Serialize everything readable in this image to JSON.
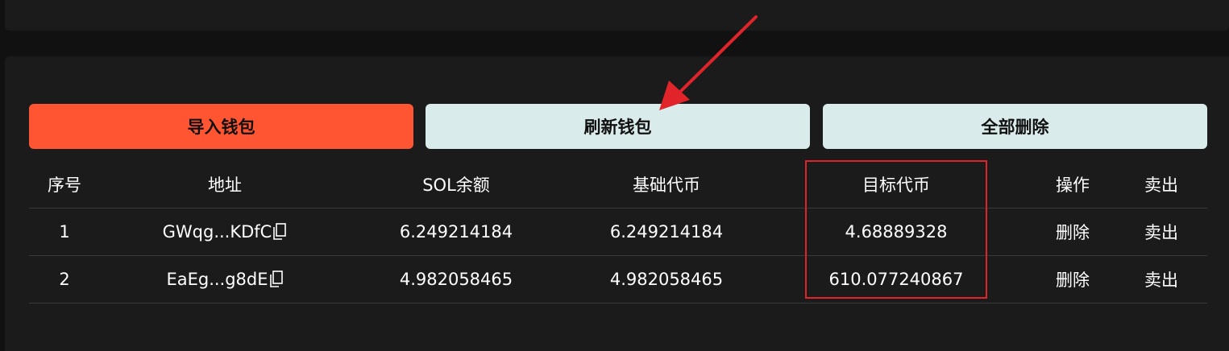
{
  "buttons": {
    "import": "导入钱包",
    "refresh": "刷新钱包",
    "delete_all": "全部删除"
  },
  "table": {
    "headers": {
      "index": "序号",
      "address": "地址",
      "sol_balance": "SOL余额",
      "base_token": "基础代币",
      "target_token": "目标代币",
      "operation": "操作",
      "sell": "卖出"
    },
    "rows": [
      {
        "index": "1",
        "address": "GWqg...KDfC",
        "sol_balance": "6.249214184",
        "base_token": "6.249214184",
        "target_token": "4.68889328",
        "delete": "删除",
        "sell": "卖出"
      },
      {
        "index": "2",
        "address": "EaEg...g8dE",
        "sol_balance": "4.982058465",
        "base_token": "4.982058465",
        "target_token": "610.077240867",
        "delete": "删除",
        "sell": "卖出"
      }
    ]
  },
  "colors": {
    "background": "#111111",
    "panel": "#1b1b1b",
    "primary_button": "#ff5533",
    "secondary_button": "#d9ebea",
    "annotation": "#e0242a"
  },
  "icons": {
    "copy": "copy-icon"
  }
}
